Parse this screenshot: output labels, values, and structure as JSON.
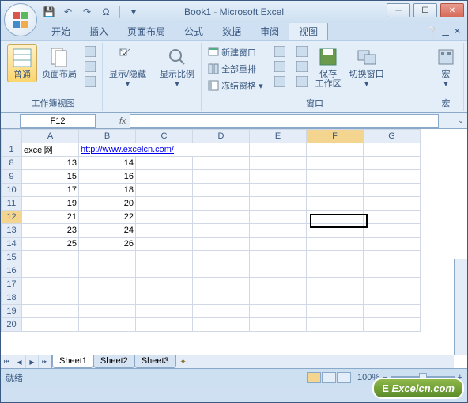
{
  "title": "Book1 - Microsoft Excel",
  "qat": {
    "save": "💾",
    "undo": "↶",
    "redo": "↷",
    "omega": "Ω"
  },
  "tabs": [
    "开始",
    "插入",
    "页面布局",
    "公式",
    "数据",
    "审阅",
    "视图"
  ],
  "active_tab": "视图",
  "ribbon": {
    "group1": {
      "normal": "普通",
      "page_layout": "页面布局",
      "label": "工作簿视图"
    },
    "group2": {
      "show_hide": "显示/隐藏"
    },
    "group3": {
      "zoom": "显示比例"
    },
    "group4": {
      "new_window": "新建窗口",
      "arrange_all": "全部重排",
      "freeze": "冻结窗格",
      "save_workspace": "保存\n工作区",
      "switch_windows": "切换窗口",
      "label": "窗口"
    },
    "group5": {
      "macros": "宏",
      "label": "宏"
    }
  },
  "namebox": "F12",
  "columns": [
    "A",
    "B",
    "C",
    "D",
    "E",
    "F",
    "G"
  ],
  "active_col": "F",
  "rows": [
    1,
    8,
    9,
    10,
    11,
    12,
    13,
    14,
    15,
    16,
    17,
    18,
    19,
    20
  ],
  "active_row": 12,
  "cells": {
    "A1": "excel网",
    "B1_link": "http://www.excelcn.com/",
    "A8": "13",
    "B8": "14",
    "A9": "15",
    "B9": "16",
    "A10": "17",
    "B10": "18",
    "A11": "19",
    "B11": "20",
    "A12": "21",
    "B12": "22",
    "A13": "23",
    "B13": "24",
    "A14": "25",
    "B14": "26"
  },
  "sheets": [
    "Sheet1",
    "Sheet2",
    "Sheet3"
  ],
  "active_sheet": "Sheet1",
  "status": "就绪",
  "zoom_pct": "100%",
  "watermark": "Excelcn.com",
  "chart_data": {
    "type": "table",
    "title": "excel网",
    "link": "http://www.excelcn.com/",
    "columns": [
      "A",
      "B"
    ],
    "rows": [
      {
        "row": 8,
        "A": 13,
        "B": 14
      },
      {
        "row": 9,
        "A": 15,
        "B": 16
      },
      {
        "row": 10,
        "A": 17,
        "B": 18
      },
      {
        "row": 11,
        "A": 19,
        "B": 20
      },
      {
        "row": 12,
        "A": 21,
        "B": 22
      },
      {
        "row": 13,
        "A": 23,
        "B": 24
      },
      {
        "row": 14,
        "A": 25,
        "B": 26
      }
    ]
  }
}
